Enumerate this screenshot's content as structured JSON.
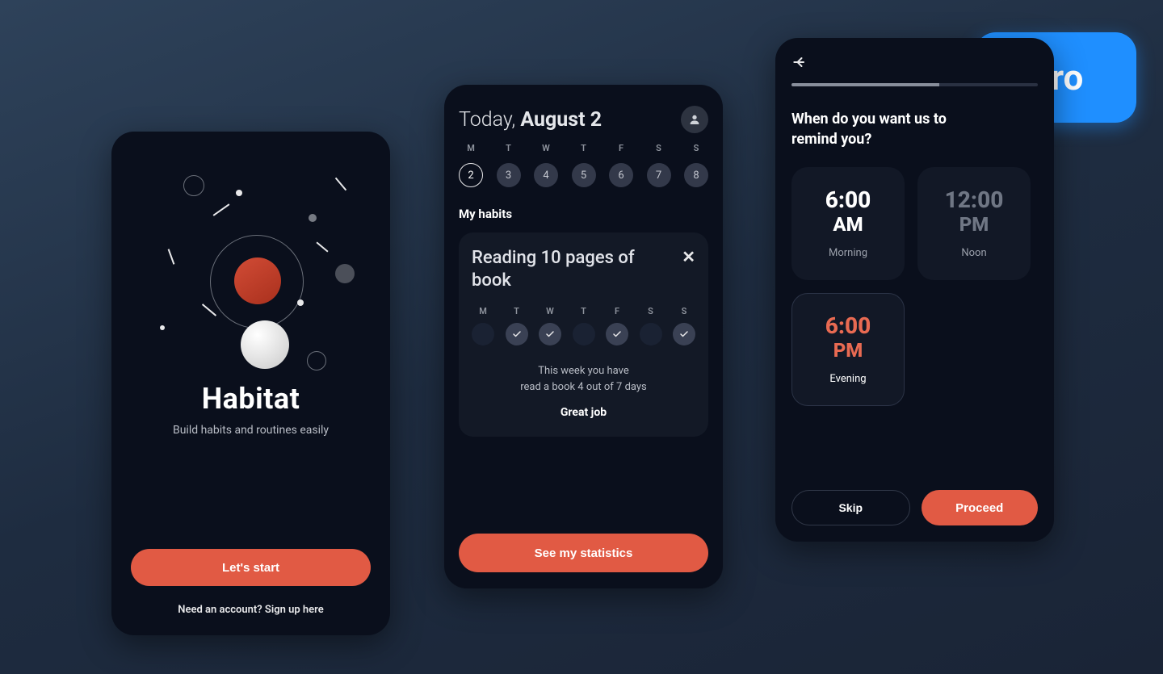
{
  "badge": {
    "label": "Pro"
  },
  "phone1": {
    "title": "Habitat",
    "subtitle": "Build habits and routines easily",
    "cta": "Let's start",
    "signup": "Need an account? Sign up here"
  },
  "phone2": {
    "today_prefix": "Today, ",
    "today_date": "August 2",
    "weekdays": [
      "M",
      "T",
      "W",
      "T",
      "F",
      "S",
      "S"
    ],
    "dates": [
      "2",
      "3",
      "4",
      "5",
      "6",
      "7",
      "8"
    ],
    "selected_index": 0,
    "my_habits_label": "My habits",
    "habit": {
      "title": "Reading 10 pages of book",
      "days": [
        {
          "lbl": "M",
          "done": false
        },
        {
          "lbl": "T",
          "done": true
        },
        {
          "lbl": "W",
          "done": true
        },
        {
          "lbl": "T",
          "done": false
        },
        {
          "lbl": "F",
          "done": true
        },
        {
          "lbl": "S",
          "done": false
        },
        {
          "lbl": "S",
          "done": true
        }
      ],
      "stats_line1": "This week you have",
      "stats_line2": "read a book 4 out of 7 days",
      "great": "Great job"
    },
    "cta": "See my statistics"
  },
  "phone3": {
    "question": "When do you want us to remind you?",
    "options": [
      {
        "time": "6:00",
        "period": "AM",
        "slot": "Morning",
        "state": "normal"
      },
      {
        "time": "12:00",
        "period": "PM",
        "slot": "Noon",
        "state": "dim"
      },
      {
        "time": "6:00",
        "period": "PM",
        "slot": "Evening",
        "state": "sel"
      }
    ],
    "skip": "Skip",
    "proceed": "Proceed"
  },
  "colors": {
    "accent": "#e15a44",
    "accent_text": "#e86a52",
    "badge": "#1f8fff"
  }
}
